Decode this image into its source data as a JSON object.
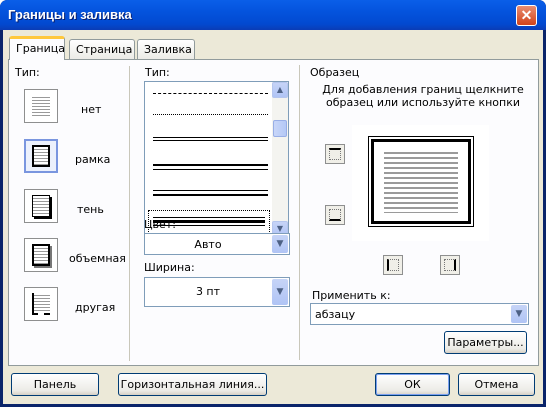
{
  "window": {
    "title": "Границы и заливка",
    "close_glyph": "✕"
  },
  "tabs": [
    {
      "label": "Граница",
      "active": true
    },
    {
      "label": "Страница",
      "active": false
    },
    {
      "label": "Заливка",
      "active": false
    }
  ],
  "type_section": {
    "label": "Тип:",
    "options": [
      {
        "label": "нет",
        "icon": "border-none-icon"
      },
      {
        "label": "рамка",
        "icon": "border-box-icon",
        "selected": true
      },
      {
        "label": "тень",
        "icon": "border-shadow-icon"
      },
      {
        "label": "объемная",
        "icon": "border-3d-icon"
      },
      {
        "label": "другая",
        "icon": "border-custom-icon"
      }
    ]
  },
  "style_section": {
    "label": "Тип:",
    "color_label": "Цвет:",
    "color_value": "Авто",
    "width_label": "Ширина:",
    "width_value": "3 пт"
  },
  "preview_section": {
    "label": "Образец",
    "hint": "Для добавления границ щелкните образец или используйте кнопки",
    "apply_label": "Применить к:",
    "apply_value": "абзацу",
    "options_button": "Параметры..."
  },
  "footer": {
    "panel_button": "Панель",
    "hline_button": "Горизонтальная линия...",
    "ok_button": "ОК",
    "cancel_button": "Отмена"
  },
  "colors": {
    "title_bar": "#0453dd",
    "dialog_bg": "#ece9d8",
    "tab_highlight": "#ffc83c"
  }
}
